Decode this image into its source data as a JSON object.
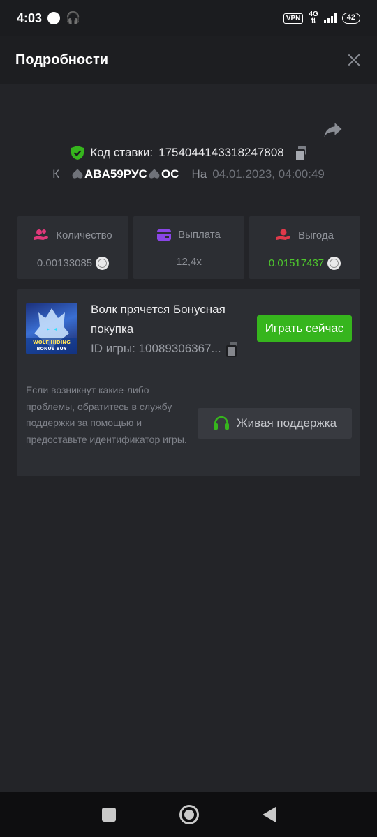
{
  "status_bar": {
    "time": "4:03",
    "vpn": "VPN",
    "network": "4G",
    "battery": "42"
  },
  "header": {
    "title": "Подробности"
  },
  "bet": {
    "code_label": "Код ставки:",
    "code_value": "1754044143318247808",
    "to_label": "К",
    "user_part1": "ABA59PУC",
    "user_part2": "OC",
    "on_label": "На",
    "date": "04.01.2023, 04:00:49"
  },
  "stats": [
    {
      "label": "Количество",
      "value": "0.00133085",
      "icon": "coins-hand-icon",
      "color": "#e0387a"
    },
    {
      "label": "Выплата",
      "value": "12,4x",
      "icon": "card-icon",
      "color": "#8a46e6"
    },
    {
      "label": "Выгода",
      "value": "0.01517437",
      "icon": "profit-hand-icon",
      "color": "#e0394a"
    }
  ],
  "game": {
    "title": "Волк прячется Бонусная покупка",
    "id_text": "ID игры: 10089306367...",
    "play_label": "Играть сейчас",
    "thumb_text_line1": "WOLF HIDING",
    "thumb_text_line2": "BONUS BUY",
    "help_text": "Если возникнут какие-либо проблемы, обратитесь в службу поддержки за помощью и предоставьте идентификатор игры.",
    "support_label": "Живая поддержка"
  },
  "colors": {
    "accent_green": "#36b51d",
    "profit_green": "#4ec72d",
    "background": "#232428",
    "card": "#2c2e33"
  }
}
